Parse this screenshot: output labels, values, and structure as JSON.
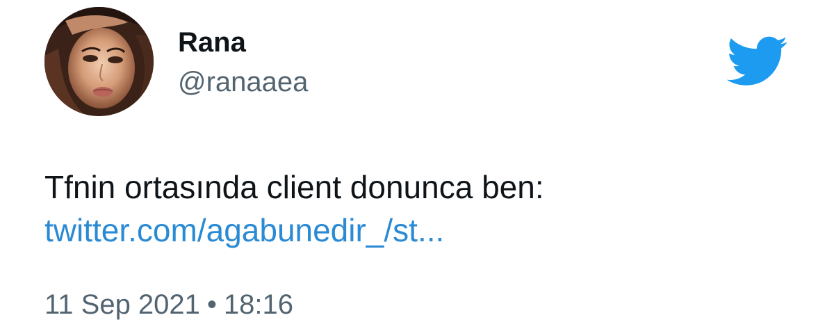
{
  "author": {
    "name": "Rana",
    "handle": "@ranaaea",
    "avatar_icon": "avatar-photo"
  },
  "tweet": {
    "text": "Tfnin ortasında client donunca ben:",
    "link": "twitter.com/agabunedir_/st...",
    "date": "11 Sep 2021",
    "separator": "•",
    "time": "18:16"
  },
  "brand": {
    "logo_icon": "twitter-bird-icon",
    "logo_color": "#1d9bf0",
    "link_color": "#2a8ad3",
    "secondary_text_color": "#536471"
  }
}
